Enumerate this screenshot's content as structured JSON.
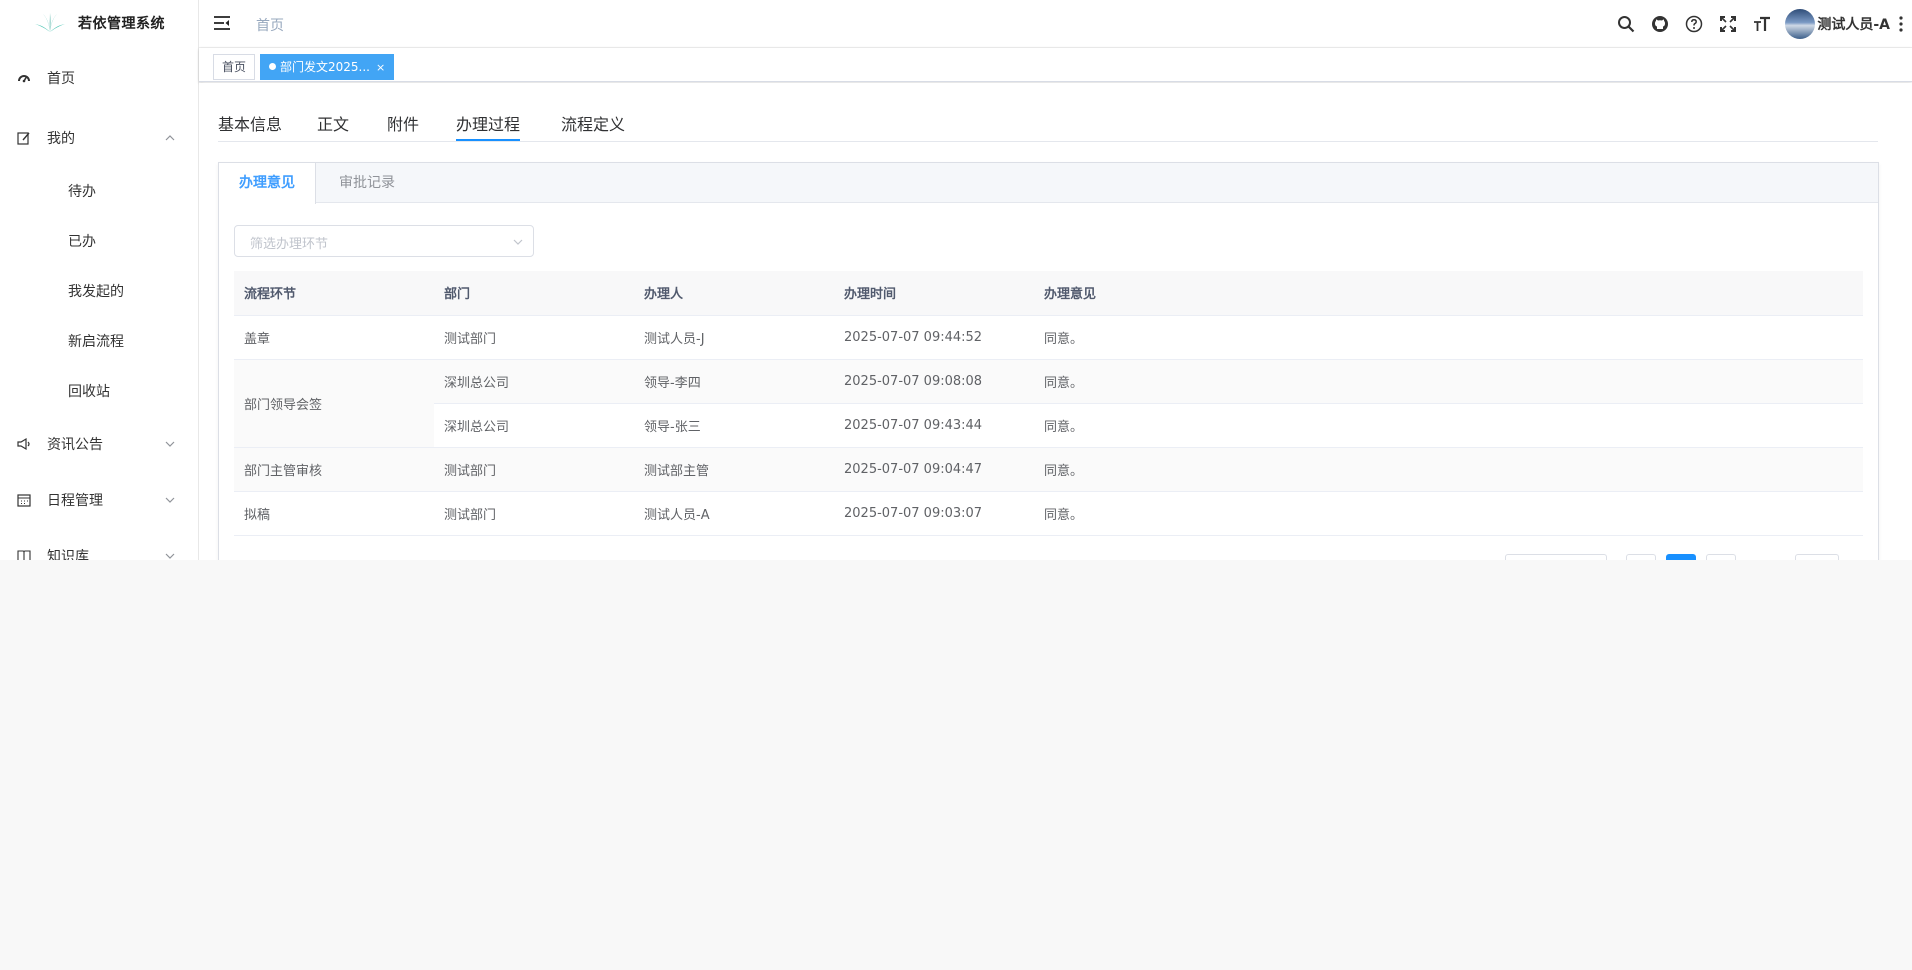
{
  "app": {
    "title": "若依管理系统"
  },
  "sidebar": {
    "items": [
      {
        "label": "首页",
        "icon": "dashboard-icon"
      },
      {
        "label": "我的",
        "icon": "edit-icon",
        "expanded": true,
        "children": [
          "待办",
          "已办",
          "我发起的",
          "新启流程",
          "回收站"
        ]
      },
      {
        "label": "资讯公告",
        "icon": "megaphone-icon"
      },
      {
        "label": "日程管理",
        "icon": "calendar-icon"
      },
      {
        "label": "知识库",
        "icon": "book-icon"
      }
    ]
  },
  "header": {
    "breadcrumb": "首页",
    "user_name": "测试人员-A"
  },
  "tags": [
    {
      "label": "首页",
      "active": false
    },
    {
      "label": "部门发文2025...",
      "active": true,
      "close": "×"
    }
  ],
  "tabs": [
    "基本信息",
    "正文",
    "附件",
    "办理过程",
    "流程定义"
  ],
  "active_tab": "办理过程",
  "inner_tabs": [
    "办理意见",
    "审批记录"
  ],
  "filter": {
    "placeholder": "筛选办理环节"
  },
  "table": {
    "headers": [
      "流程环节",
      "部门",
      "办理人",
      "办理时间",
      "办理意见"
    ],
    "rows": [
      {
        "step": "盖章",
        "dept": "测试部门",
        "person": "测试人员-J",
        "time": "2025-07-07 09:44:52",
        "opinion": "同意。"
      },
      {
        "step": "部门领导会签",
        "dept": "深圳总公司",
        "person": "领导-李四",
        "time": "2025-07-07 09:08:08",
        "opinion": "同意。"
      },
      {
        "step": "",
        "dept": "深圳总公司",
        "person": "领导-张三",
        "time": "2025-07-07 09:43:44",
        "opinion": "同意。"
      },
      {
        "step": "部门主管审核",
        "dept": "测试部门",
        "person": "测试部主管",
        "time": "2025-07-07 09:04:47",
        "opinion": "同意。"
      },
      {
        "step": "拟稿",
        "dept": "测试部门",
        "person": "测试人员-A",
        "time": "2025-07-07 09:03:07",
        "opinion": "同意。"
      }
    ]
  },
  "colors": {
    "primary": "#1890ff",
    "tag_active": "#42a5f5",
    "inner_tab_active": "#409eff"
  }
}
